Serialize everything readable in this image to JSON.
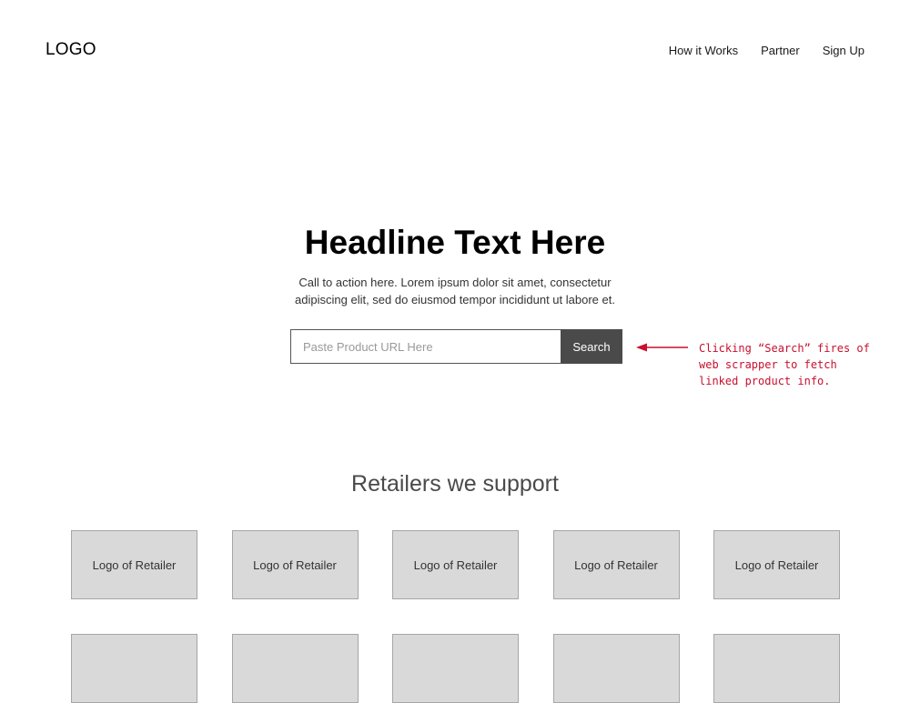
{
  "header": {
    "logo": "LOGO",
    "nav": [
      {
        "label": "How it Works"
      },
      {
        "label": "Partner"
      },
      {
        "label": "Sign Up"
      }
    ]
  },
  "hero": {
    "headline": "Headline Text Here",
    "cta_text": "Call to action here. Lorem ipsum dolor sit amet, consectetur adipiscing elit, sed do eiusmod tempor incididunt ut labore et.",
    "search": {
      "placeholder": "Paste Product URL Here",
      "value": "",
      "button_label": "Search"
    }
  },
  "annotation": {
    "lines": [
      "Clicking “Search” fires of",
      "web scrapper to fetch",
      "linked product info."
    ],
    "color": "#c8102e"
  },
  "retailers": {
    "title": "Retailers we support",
    "tiles": [
      {
        "label": "Logo of Retailer"
      },
      {
        "label": "Logo of Retailer"
      },
      {
        "label": "Logo of Retailer"
      },
      {
        "label": "Logo of Retailer"
      },
      {
        "label": "Logo of Retailer"
      },
      {
        "label": ""
      },
      {
        "label": ""
      },
      {
        "label": ""
      },
      {
        "label": ""
      },
      {
        "label": ""
      }
    ]
  }
}
